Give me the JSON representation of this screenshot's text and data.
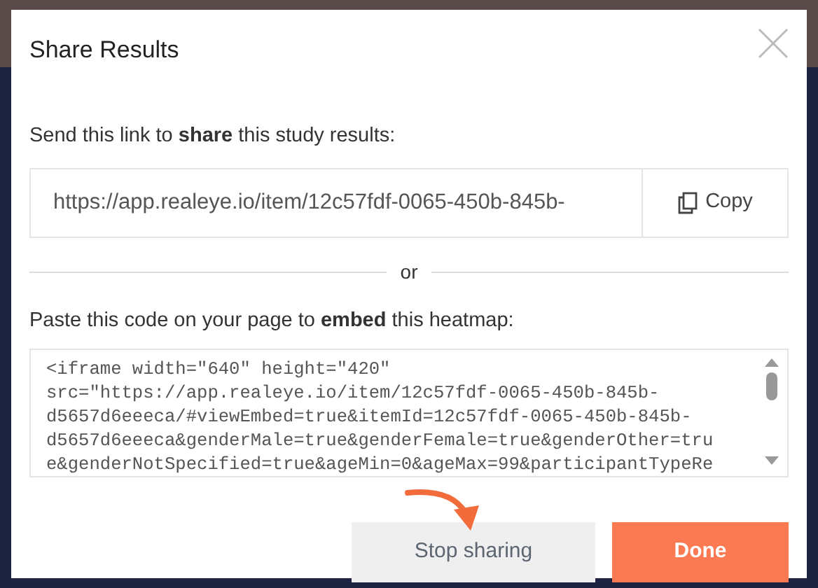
{
  "dialog": {
    "title": "Share Results",
    "share_label": "Send this link to **share** this study results:",
    "link_field": {
      "value": "https://app.realeye.io/item/12c57fdf-0065-450b-845b-"
    },
    "copy_button": "Copy",
    "divider_text": "or",
    "embed_label": "Paste this code on your page to **embed** this heatmap:",
    "embed_code": "<iframe width=\"640\" height=\"420\" src=\"https://app.realeye.io/item/12c57fdf-0065-450b-845b-d5657d6eeeca/#viewEmbed=true&itemId=12c57fdf-0065-450b-845b-d5657d6eeeca&genderMale=true&genderFemale=true&genderOther=true&genderNotSpecified=true&ageMin=0&ageMax=99&participantTypeRe",
    "buttons": [
      {
        "label": "Stop sharing",
        "kind": "secondary"
      },
      {
        "label": "Done",
        "kind": "primary"
      }
    ]
  }
}
